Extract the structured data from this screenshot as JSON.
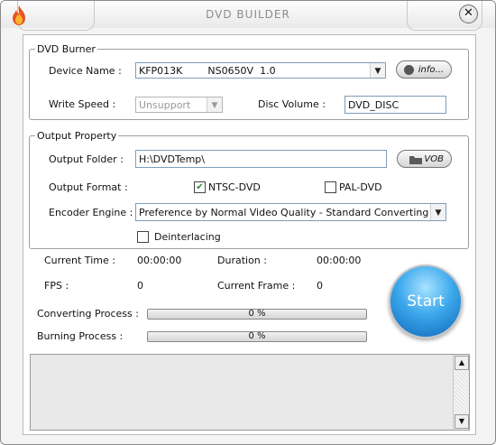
{
  "window": {
    "title": "DVD BUILDER"
  },
  "dvd_burner": {
    "legend": "DVD Burner",
    "device_name_label": "Device Name :",
    "device_name_value": "KFP013K        NS0650V  1.0",
    "info_button": "info...",
    "write_speed_label": "Write Speed :",
    "write_speed_value": "Unsupport",
    "disc_volume_label": "Disc Volume :",
    "disc_volume_value": "DVD_DISC"
  },
  "output_property": {
    "legend": "Output Property",
    "output_folder_label": "Output Folder :",
    "output_folder_value": "H:\\DVDTemp\\",
    "vob_button": "VOB",
    "output_format_label": "Output Format :",
    "ntsc_label": "NTSC-DVD",
    "ntsc_checked": true,
    "pal_label": "PAL-DVD",
    "pal_checked": false,
    "encoder_label": "Encoder Engine :",
    "encoder_value": "Preference by Normal Video Quality - Standard Converting speed",
    "deinterlacing_label": "Deinterlacing",
    "deinterlacing_checked": false
  },
  "status": {
    "current_time_label": "Current Time :",
    "current_time_value": "00:00:00",
    "duration_label": "Duration :",
    "duration_value": "00:00:00",
    "fps_label": "FPS :",
    "fps_value": "0",
    "current_frame_label": "Current Frame :",
    "current_frame_value": "0",
    "converting_label": "Converting Process :",
    "converting_value": "0 %",
    "burning_label": "Burning Process :",
    "burning_value": "0 %"
  },
  "start_button": "Start"
}
